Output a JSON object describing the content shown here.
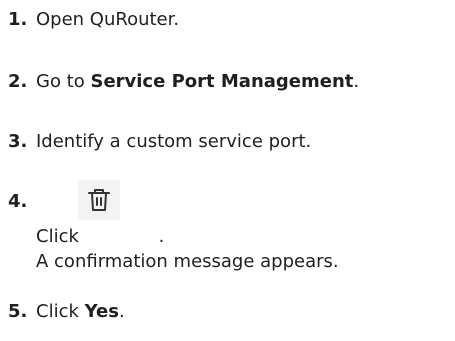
{
  "steps": [
    {
      "number": "1.",
      "text": "Open QuRouter."
    },
    {
      "number": "2.",
      "prefix": "Go to ",
      "bold": "Service Port Management",
      "suffix": "."
    },
    {
      "number": "3.",
      "text": "Identify a custom service port."
    },
    {
      "number": "4.",
      "prefix": "Click ",
      "icon": "trash-icon",
      "suffix": ".",
      "note": "A confirmation message appears."
    },
    {
      "number": "5.",
      "prefix": "Click ",
      "bold": "Yes",
      "suffix": "."
    }
  ]
}
